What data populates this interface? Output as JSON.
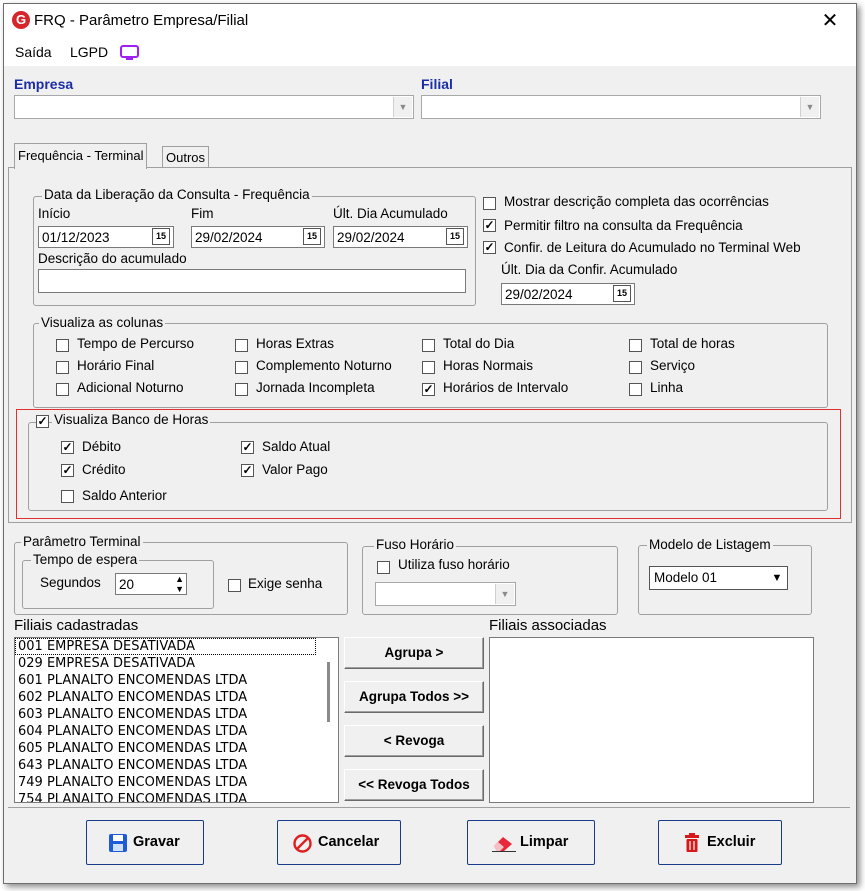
{
  "window": {
    "title": "FRQ - Parâmetro Empresa/Filial",
    "close": "✕"
  },
  "menu": {
    "items": [
      "Saída",
      "LGPD"
    ]
  },
  "empresa": {
    "label": "Empresa",
    "value": ""
  },
  "filial": {
    "label": "Filial",
    "value": ""
  },
  "tabs": [
    {
      "label": "Frequência - Terminal",
      "active": true
    },
    {
      "label": "Outros",
      "active": false
    }
  ],
  "liberacao": {
    "legend": "Data da Liberação da Consulta  - Frequência",
    "inicio_label": "Início",
    "inicio_value": "01/12/2023",
    "fim_label": "Fim",
    "fim_value": "29/02/2024",
    "ult_label": "Últ. Dia Acumulado",
    "ult_value": "29/02/2024",
    "desc_label": "Descrição do acumulado",
    "desc_value": "",
    "cal_icon": "15"
  },
  "options": [
    {
      "label": "Mostrar descrição completa das ocorrências",
      "checked": false
    },
    {
      "label": "Permitir filtro na consulta da Frequência",
      "checked": true
    },
    {
      "label": "Confir. de Leitura do Acumulado no Terminal Web",
      "checked": true
    }
  ],
  "confir": {
    "label": "Últ. Dia da Confir. Acumulado",
    "value": "29/02/2024"
  },
  "colunas": {
    "legend": "Visualiza as colunas",
    "items": [
      {
        "label": "Tempo de Percurso",
        "checked": false
      },
      {
        "label": "Horário Final",
        "checked": false
      },
      {
        "label": "Adicional Noturno",
        "checked": false
      },
      {
        "label": "Horas Extras",
        "checked": false
      },
      {
        "label": "Complemento Noturno",
        "checked": false
      },
      {
        "label": "Jornada Incompleta",
        "checked": false
      },
      {
        "label": "Total do Dia",
        "checked": false
      },
      {
        "label": "Horas Normais",
        "checked": false
      },
      {
        "label": "Horários de Intervalo",
        "checked": true
      },
      {
        "label": "Total de horas",
        "checked": false
      },
      {
        "label": "Serviço",
        "checked": false
      },
      {
        "label": "Linha",
        "checked": false
      }
    ]
  },
  "banco": {
    "legend": "Visualiza Banco de Horas",
    "checked": true,
    "items": [
      {
        "label": "Débito",
        "checked": true
      },
      {
        "label": "Crédito",
        "checked": true
      },
      {
        "label": "Saldo Anterior",
        "checked": false
      },
      {
        "label": "Saldo Atual",
        "checked": true
      },
      {
        "label": "Valor Pago",
        "checked": true
      }
    ]
  },
  "terminal": {
    "legend": "Parâmetro Terminal",
    "espera_legend": "Tempo de espera",
    "segundos_label": "Segundos",
    "segundos_value": "20",
    "exige_label": "Exige senha",
    "exige_checked": false
  },
  "fuso": {
    "legend": "Fuso Horário",
    "utiliza_label": "Utiliza fuso horário",
    "utiliza_checked": false,
    "value": ""
  },
  "modelo": {
    "legend": "Modelo de Listagem",
    "value": "Modelo 01"
  },
  "cadastradas": {
    "label": "Filiais cadastradas",
    "items": [
      "001 EMPRESA DESATIVADA",
      "029 EMPRESA DESATIVADA",
      "601 PLANALTO ENCOMENDAS LTDA",
      "602 PLANALTO ENCOMENDAS LTDA",
      "603 PLANALTO ENCOMENDAS LTDA",
      "604 PLANALTO ENCOMENDAS LTDA",
      "605 PLANALTO ENCOMENDAS LTDA",
      "643 PLANALTO ENCOMENDAS LTDA",
      "749 PLANALTO ENCOMENDAS LTDA",
      "754 PLANALTO ENCOMENDAS LTDA"
    ]
  },
  "associadas": {
    "label": "Filiais associadas",
    "items": []
  },
  "transfer": {
    "agrupa": "Agrupa >",
    "agrupa_todos": "Agrupa Todos >>",
    "revoga": "< Revoga",
    "revoga_todos": "<< Revoga Todos"
  },
  "actions": {
    "gravar": "Gravar",
    "cancelar": "Cancelar",
    "limpar": "Limpar",
    "excluir": "Excluir"
  },
  "colors": {
    "label_blue": "#1c2ea5",
    "highlight_red": "#e03030",
    "accent_purple": "#a020f0",
    "save_blue": "#1e5bd6",
    "cancel_red": "#e02020",
    "clear_red": "#e8283a",
    "delete_red": "#d81818"
  }
}
